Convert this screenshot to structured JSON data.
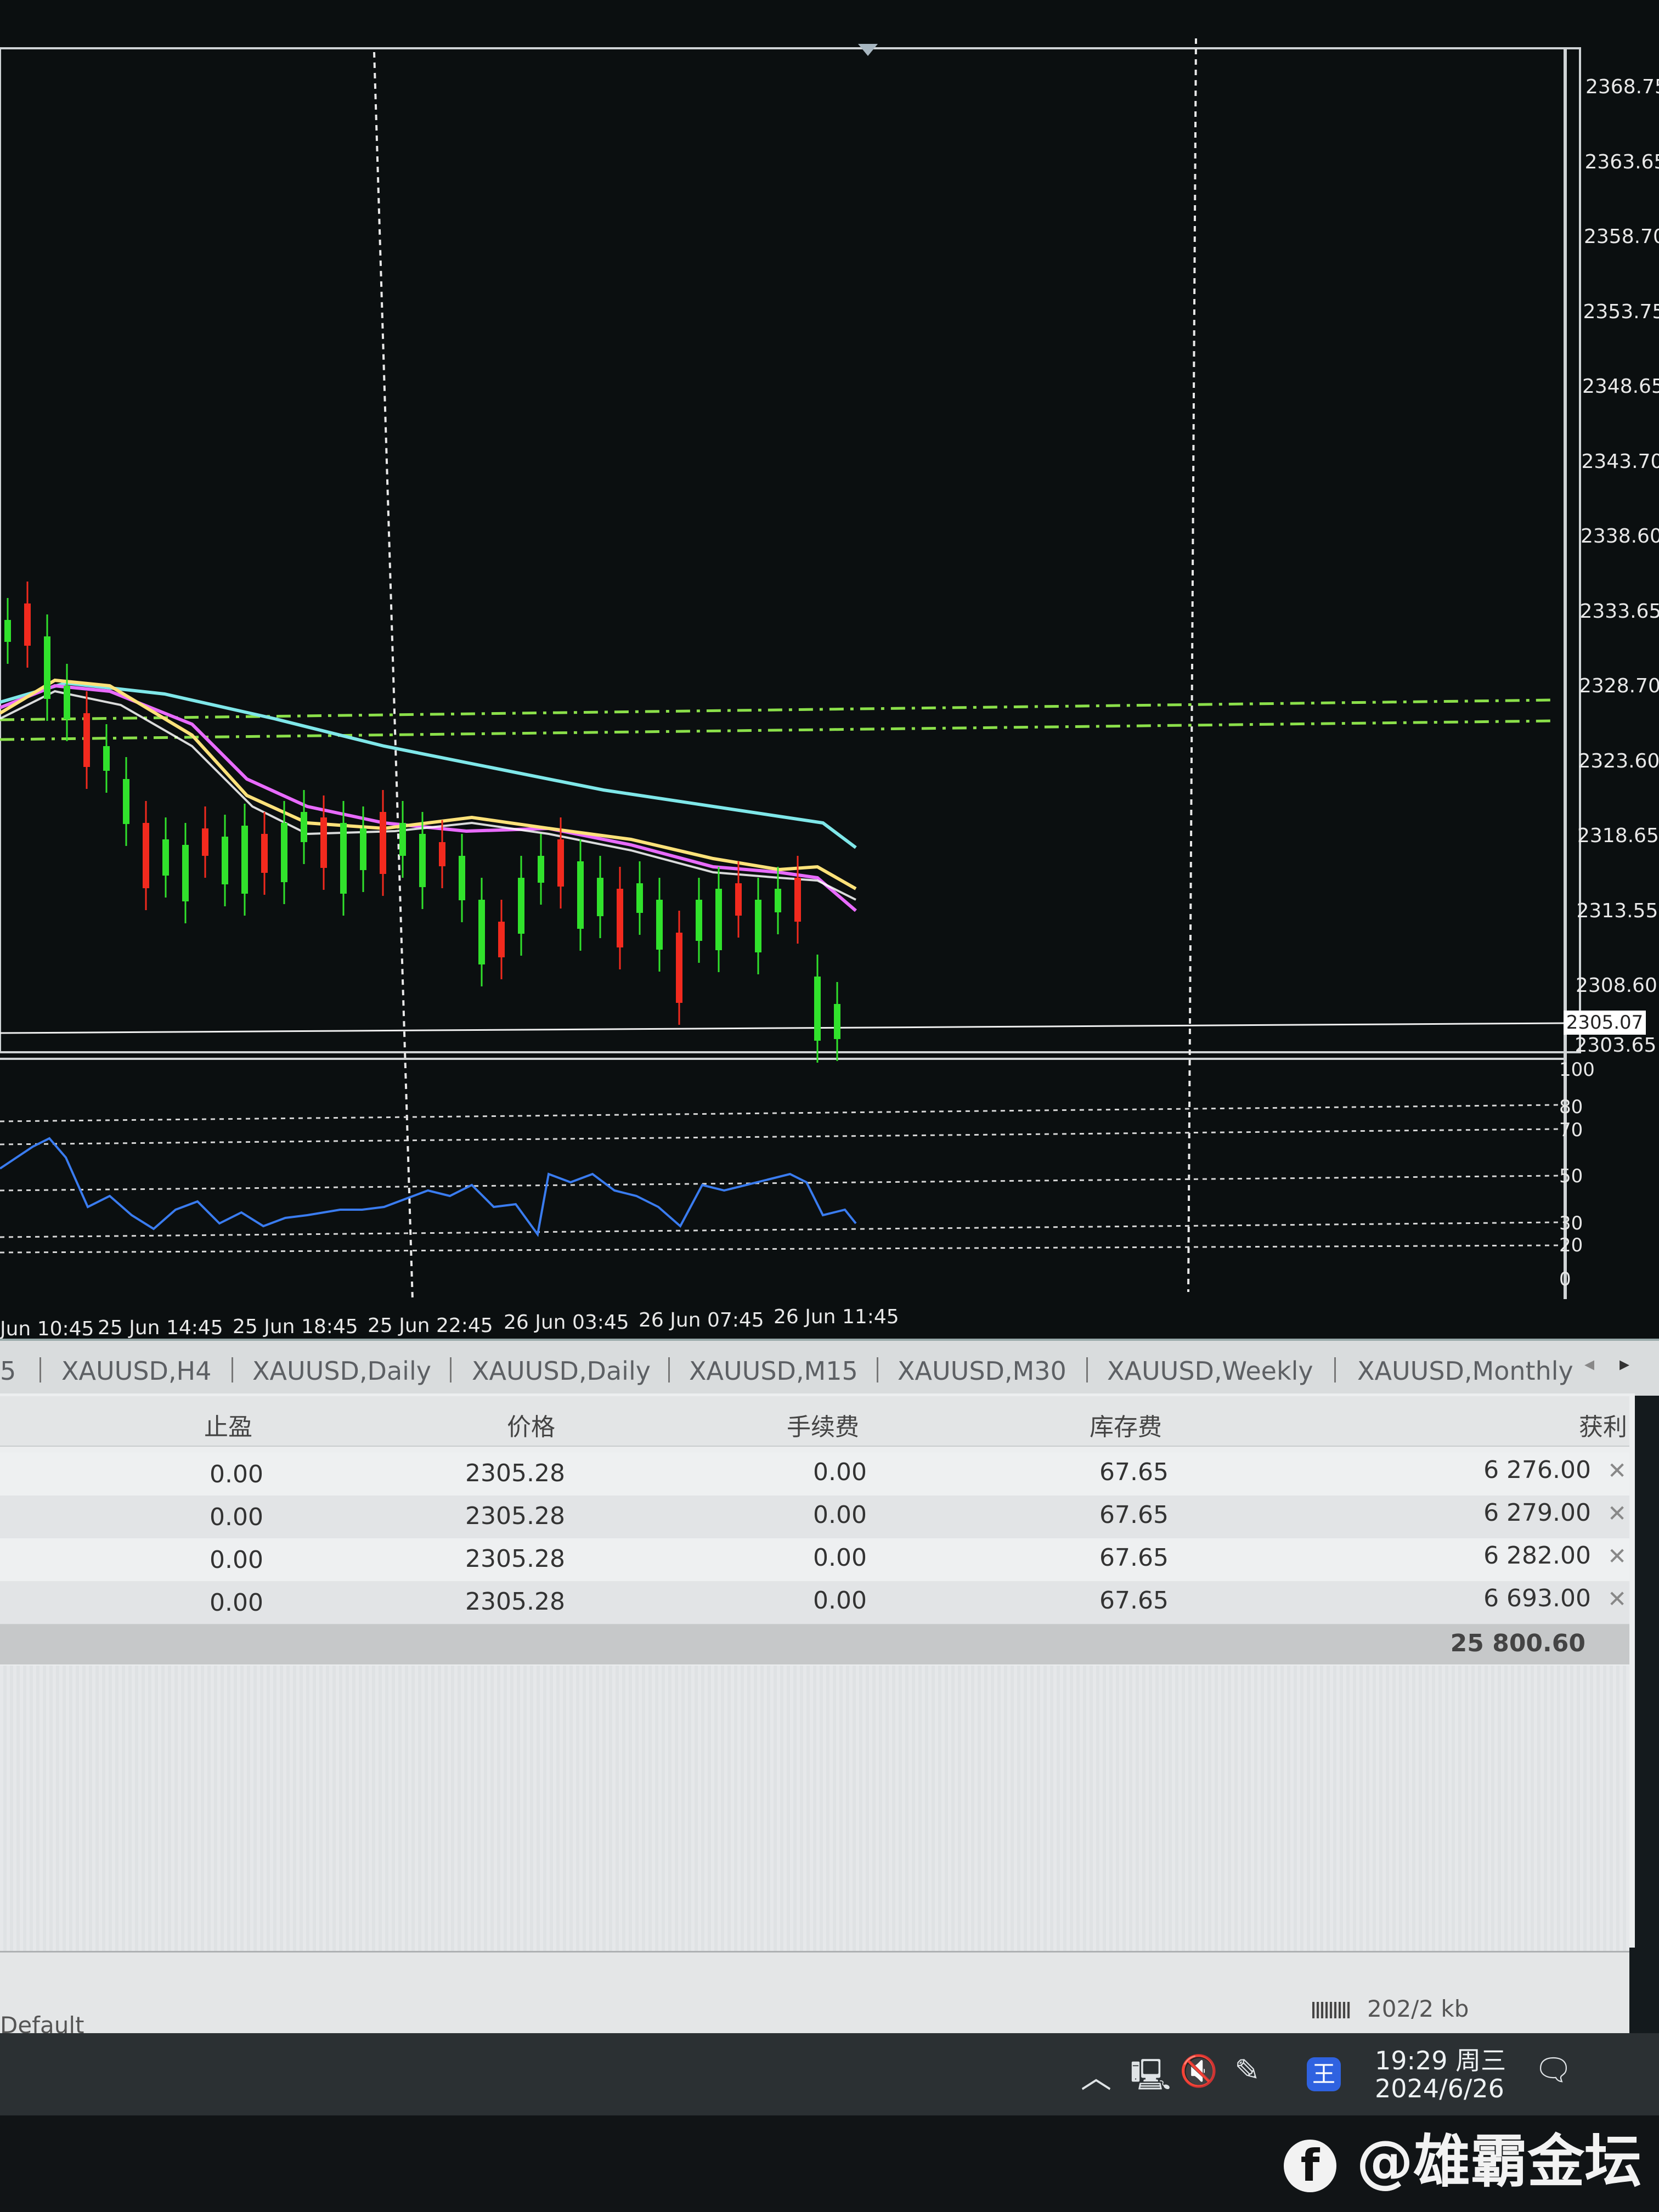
{
  "chart": {
    "price_axis": [
      "2368.75",
      "2363.65",
      "2358.70",
      "2353.75",
      "2348.65",
      "2343.70",
      "2338.60",
      "2333.65",
      "2328.70",
      "2323.60",
      "2318.65",
      "2313.55",
      "2308.60",
      "2303.65"
    ],
    "current_price": "2305.07",
    "rsi_axis": [
      "100",
      "80",
      "70",
      "50",
      "30",
      "20",
      "0"
    ],
    "time_axis": [
      "Jun 10:45",
      "25 Jun 14:45",
      "25 Jun 18:45",
      "25 Jun 22:45",
      "26 Jun 03:45",
      "26 Jun 07:45",
      "26 Jun 11:45"
    ],
    "colors": {
      "bull": "#31e22c",
      "bear": "#f22a1e",
      "rsi": "#3a7cf0",
      "level": "#8be04a"
    }
  },
  "tabs": [
    "5",
    "XAUUSD,H4",
    "XAUUSD,Daily",
    "XAUUSD,Daily",
    "XAUUSD,M15",
    "XAUUSD,M30",
    "XAUUSD,Weekly",
    "XAUUSD,Monthly"
  ],
  "table": {
    "headers": {
      "tp": "止盈",
      "price": "价格",
      "commission": "手续费",
      "swap": "库存费",
      "profit": "获利"
    },
    "rows": [
      {
        "tp": "0.00",
        "price": "2305.28",
        "commission": "0.00",
        "swap": "67.65",
        "profit": "6 276.00"
      },
      {
        "tp": "0.00",
        "price": "2305.28",
        "commission": "0.00",
        "swap": "67.65",
        "profit": "6 279.00"
      },
      {
        "tp": "0.00",
        "price": "2305.28",
        "commission": "0.00",
        "swap": "67.65",
        "profit": "6 282.00"
      },
      {
        "tp": "0.00",
        "price": "2305.28",
        "commission": "0.00",
        "swap": "67.65",
        "profit": "6 693.00"
      }
    ],
    "total": "25 800.60"
  },
  "statusbar": {
    "profile": "Default",
    "traffic": "202/2 kb"
  },
  "taskbar": {
    "time": "19:29 周三",
    "date": "2024/6/26",
    "ime": "王"
  },
  "watermark": "@雄霸金坛"
}
